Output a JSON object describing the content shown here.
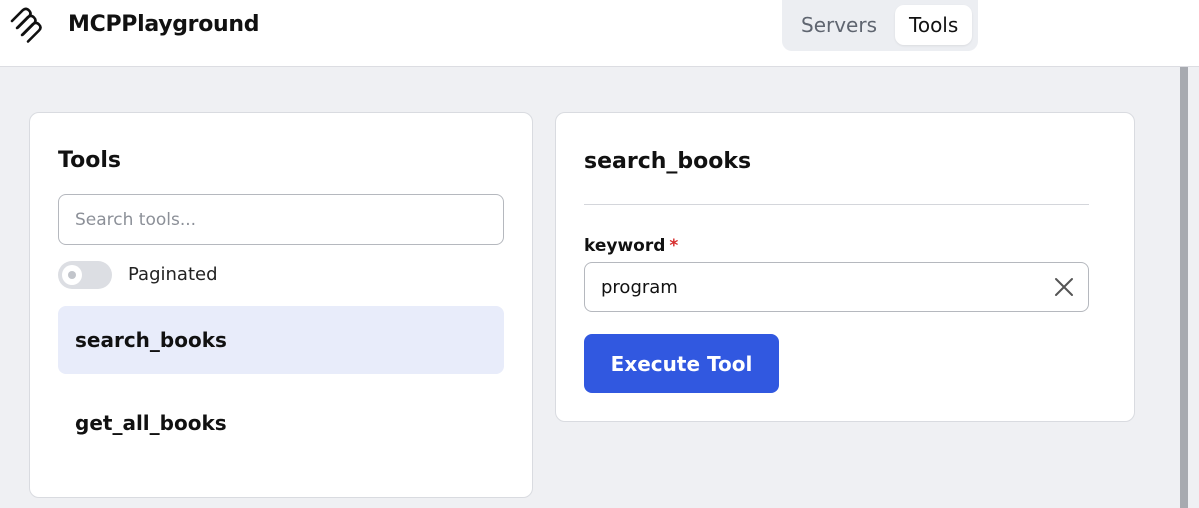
{
  "header": {
    "brand": "MCPPlayground",
    "logo_icon": "stacked-lines-logo-icon",
    "nav": [
      {
        "label": "Servers",
        "active": false
      },
      {
        "label": "Tools",
        "active": true
      }
    ]
  },
  "tools_panel": {
    "title": "Tools",
    "search_placeholder": "Search tools...",
    "paginated_label": "Paginated",
    "paginated_on": false,
    "items": [
      {
        "label": "search_books",
        "selected": true
      },
      {
        "label": "get_all_books",
        "selected": false
      }
    ]
  },
  "detail": {
    "title": "search_books",
    "field_label": "keyword",
    "required_mark": "*",
    "field_value": "program",
    "clear_icon": "close-icon",
    "execute_label": "Execute Tool"
  },
  "colors": {
    "accent": "#3158e0",
    "selected_bg": "#e8ecfa",
    "required": "#d62c2c",
    "page_bg": "#eff0f3"
  }
}
